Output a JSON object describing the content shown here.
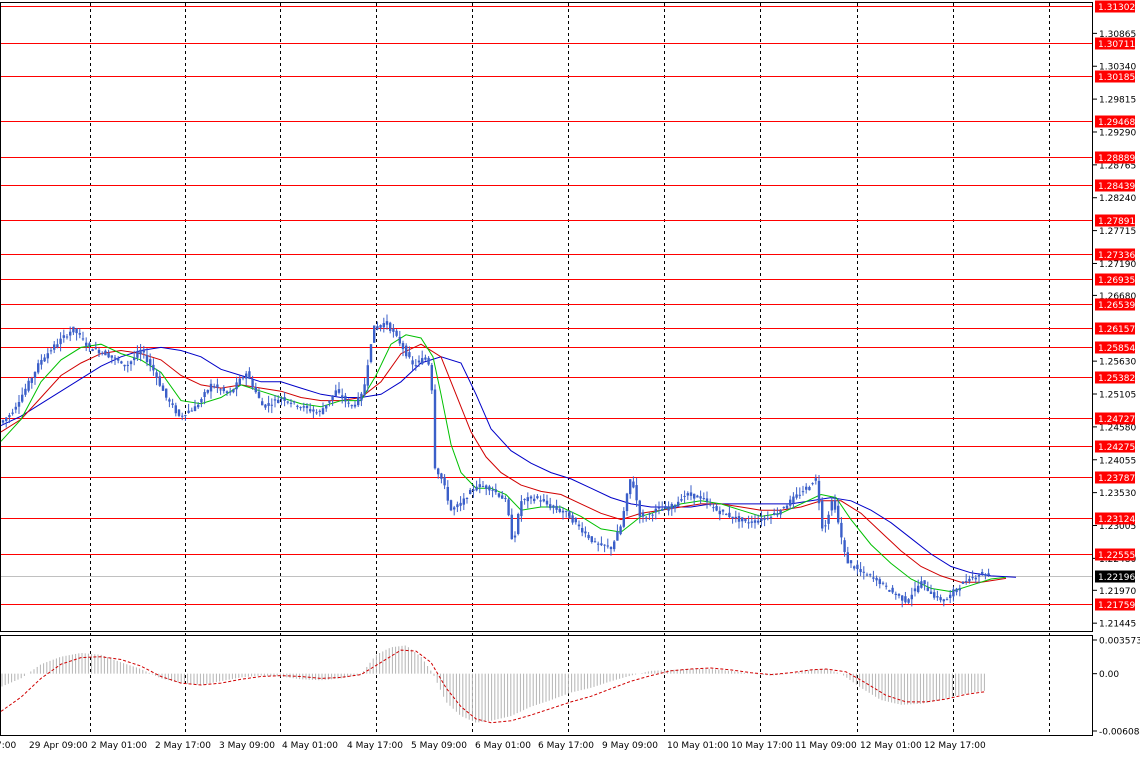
{
  "chart_data": [
    {
      "type": "candlestick",
      "symbol_title": "",
      "price_range": [
        1.2132,
        1.3135
      ],
      "price_ticks": [
        "1.30865",
        "1.30340",
        "1.29815",
        "1.29290",
        "1.28765",
        "1.28240",
        "1.27715",
        "1.27190",
        "1.26680",
        "1.25630",
        "1.25105",
        "1.24580",
        "1.24055",
        "1.23530",
        "1.23005",
        "1.22480",
        "1.21970",
        "1.21445"
      ],
      "levels": [
        "1.31302",
        "1.30711",
        "1.30185",
        "1.29468",
        "1.28889",
        "1.28439",
        "1.27891",
        "1.27336",
        "1.26935",
        "1.26539",
        "1.26157",
        "1.25854",
        "1.25382",
        "1.24727",
        "1.24275",
        "1.23787",
        "1.23124",
        "1.22555",
        "1.21759"
      ],
      "current_price": "1.22196",
      "time_labels": [
        "7:00",
        "29 Apr 09:00",
        "2 May 01:00",
        "2 May 17:00",
        "3 May 09:00",
        "4 May 01:00",
        "4 May 17:00",
        "5 May 09:00",
        "6 May 01:00",
        "6 May 17:00",
        "9 May 09:00",
        "10 May 01:00",
        "10 May 17:00",
        "11 May 09:00",
        "12 May 01:00",
        "12 May 17:00"
      ],
      "price_path": [
        [
          0,
          1.2465
        ],
        [
          10,
          1.248
        ],
        [
          25,
          1.252
        ],
        [
          40,
          1.2565
        ],
        [
          55,
          1.259
        ],
        [
          72,
          1.2615
        ],
        [
          88,
          1.2585
        ],
        [
          105,
          1.2575
        ],
        [
          125,
          1.2555
        ],
        [
          140,
          1.258
        ],
        [
          152,
          1.255
        ],
        [
          165,
          1.2505
        ],
        [
          178,
          1.2475
        ],
        [
          195,
          1.249
        ],
        [
          210,
          1.2525
        ],
        [
          228,
          1.251
        ],
        [
          245,
          1.2545
        ],
        [
          262,
          1.249
        ],
        [
          280,
          1.2505
        ],
        [
          300,
          1.249
        ],
        [
          318,
          1.248
        ],
        [
          335,
          1.2515
        ],
        [
          350,
          1.249
        ],
        [
          362,
          1.251
        ],
        [
          372,
          1.2615
        ],
        [
          385,
          1.2625
        ],
        [
          400,
          1.259
        ],
        [
          412,
          1.2555
        ],
        [
          425,
          1.257
        ],
        [
          430,
          1.255
        ],
        [
          434,
          1.2395
        ],
        [
          442,
          1.237
        ],
        [
          450,
          1.2325
        ],
        [
          460,
          1.2335
        ],
        [
          475,
          1.2365
        ],
        [
          490,
          1.236
        ],
        [
          505,
          1.234
        ],
        [
          512,
          1.227
        ],
        [
          520,
          1.234
        ],
        [
          535,
          1.2345
        ],
        [
          550,
          1.233
        ],
        [
          565,
          1.232
        ],
        [
          580,
          1.2295
        ],
        [
          595,
          1.227
        ],
        [
          610,
          1.2265
        ],
        [
          620,
          1.23
        ],
        [
          630,
          1.238
        ],
        [
          640,
          1.231
        ],
        [
          655,
          1.2325
        ],
        [
          670,
          1.233
        ],
        [
          685,
          1.235
        ],
        [
          700,
          1.2345
        ],
        [
          715,
          1.2325
        ],
        [
          730,
          1.2315
        ],
        [
          745,
          1.2305
        ],
        [
          760,
          1.231
        ],
        [
          775,
          1.232
        ],
        [
          790,
          1.234
        ],
        [
          805,
          1.236
        ],
        [
          815,
          1.2375
        ],
        [
          822,
          1.229
        ],
        [
          832,
          1.2345
        ],
        [
          845,
          1.2245
        ],
        [
          860,
          1.2225
        ],
        [
          875,
          1.2215
        ],
        [
          890,
          1.2195
        ],
        [
          905,
          1.218
        ],
        [
          920,
          1.221
        ],
        [
          935,
          1.2185
        ],
        [
          945,
          1.218
        ],
        [
          955,
          1.22
        ],
        [
          968,
          1.2215
        ],
        [
          980,
          1.2225
        ],
        [
          990,
          1.222
        ]
      ],
      "ma_fast": [
        [
          0,
          1.2435
        ],
        [
          20,
          1.247
        ],
        [
          40,
          1.253
        ],
        [
          60,
          1.2565
        ],
        [
          80,
          1.2585
        ],
        [
          100,
          1.259
        ],
        [
          120,
          1.2575
        ],
        [
          140,
          1.2565
        ],
        [
          160,
          1.2545
        ],
        [
          180,
          1.25
        ],
        [
          200,
          1.2495
        ],
        [
          220,
          1.2505
        ],
        [
          240,
          1.2525
        ],
        [
          260,
          1.2515
        ],
        [
          280,
          1.2505
        ],
        [
          300,
          1.2495
        ],
        [
          320,
          1.249
        ],
        [
          340,
          1.25
        ],
        [
          360,
          1.25
        ],
        [
          375,
          1.254
        ],
        [
          390,
          1.259
        ],
        [
          405,
          1.2605
        ],
        [
          420,
          1.26
        ],
        [
          432,
          1.257
        ],
        [
          440,
          1.251
        ],
        [
          450,
          1.243
        ],
        [
          460,
          1.2385
        ],
        [
          475,
          1.236
        ],
        [
          490,
          1.236
        ],
        [
          505,
          1.235
        ],
        [
          520,
          1.2325
        ],
        [
          540,
          1.233
        ],
        [
          560,
          1.233
        ],
        [
          580,
          1.2315
        ],
        [
          600,
          1.2295
        ],
        [
          620,
          1.229
        ],
        [
          640,
          1.2315
        ],
        [
          660,
          1.2325
        ],
        [
          680,
          1.2335
        ],
        [
          700,
          1.234
        ],
        [
          720,
          1.2335
        ],
        [
          740,
          1.2325
        ],
        [
          760,
          1.2315
        ],
        [
          780,
          1.232
        ],
        [
          800,
          1.2335
        ],
        [
          820,
          1.235
        ],
        [
          835,
          1.2345
        ],
        [
          850,
          1.231
        ],
        [
          870,
          1.227
        ],
        [
          890,
          1.224
        ],
        [
          910,
          1.2215
        ],
        [
          930,
          1.22
        ],
        [
          950,
          1.2195
        ],
        [
          970,
          1.2205
        ],
        [
          990,
          1.2215
        ],
        [
          1005,
          1.2218
        ]
      ],
      "ma_mid": [
        [
          0,
          1.245
        ],
        [
          20,
          1.247
        ],
        [
          40,
          1.2505
        ],
        [
          60,
          1.254
        ],
        [
          80,
          1.256
        ],
        [
          100,
          1.2575
        ],
        [
          120,
          1.258
        ],
        [
          140,
          1.2575
        ],
        [
          160,
          1.2565
        ],
        [
          180,
          1.254
        ],
        [
          200,
          1.2525
        ],
        [
          220,
          1.252
        ],
        [
          240,
          1.2525
        ],
        [
          260,
          1.252
        ],
        [
          280,
          1.2515
        ],
        [
          300,
          1.2505
        ],
        [
          320,
          1.25
        ],
        [
          340,
          1.25
        ],
        [
          360,
          1.2505
        ],
        [
          380,
          1.253
        ],
        [
          400,
          1.2575
        ],
        [
          420,
          1.259
        ],
        [
          440,
          1.257
        ],
        [
          455,
          1.251
        ],
        [
          470,
          1.245
        ],
        [
          485,
          1.241
        ],
        [
          500,
          1.2385
        ],
        [
          520,
          1.2365
        ],
        [
          540,
          1.2355
        ],
        [
          560,
          1.235
        ],
        [
          580,
          1.2335
        ],
        [
          600,
          1.232
        ],
        [
          620,
          1.231
        ],
        [
          640,
          1.232
        ],
        [
          660,
          1.2325
        ],
        [
          680,
          1.233
        ],
        [
          700,
          1.2335
        ],
        [
          720,
          1.2335
        ],
        [
          740,
          1.233
        ],
        [
          760,
          1.2325
        ],
        [
          780,
          1.2325
        ],
        [
          800,
          1.233
        ],
        [
          820,
          1.234
        ],
        [
          840,
          1.234
        ],
        [
          860,
          1.232
        ],
        [
          880,
          1.229
        ],
        [
          900,
          1.226
        ],
        [
          920,
          1.2235
        ],
        [
          940,
          1.222
        ],
        [
          960,
          1.221
        ],
        [
          980,
          1.221
        ],
        [
          1005,
          1.2216
        ]
      ],
      "ma_slow": [
        [
          0,
          1.246
        ],
        [
          20,
          1.2475
        ],
        [
          40,
          1.2495
        ],
        [
          60,
          1.2515
        ],
        [
          80,
          1.2535
        ],
        [
          100,
          1.2555
        ],
        [
          120,
          1.257
        ],
        [
          140,
          1.258
        ],
        [
          160,
          1.2585
        ],
        [
          180,
          1.258
        ],
        [
          200,
          1.257
        ],
        [
          220,
          1.255
        ],
        [
          240,
          1.254
        ],
        [
          260,
          1.253
        ],
        [
          280,
          1.253
        ],
        [
          300,
          1.252
        ],
        [
          320,
          1.251
        ],
        [
          340,
          1.2505
        ],
        [
          360,
          1.2505
        ],
        [
          380,
          1.251
        ],
        [
          400,
          1.253
        ],
        [
          420,
          1.256
        ],
        [
          440,
          1.257
        ],
        [
          460,
          1.256
        ],
        [
          475,
          1.251
        ],
        [
          490,
          1.2455
        ],
        [
          510,
          1.242
        ],
        [
          530,
          1.24
        ],
        [
          550,
          1.2385
        ],
        [
          570,
          1.2375
        ],
        [
          590,
          1.236
        ],
        [
          610,
          1.2345
        ],
        [
          630,
          1.2335
        ],
        [
          650,
          1.233
        ],
        [
          670,
          1.233
        ],
        [
          690,
          1.233
        ],
        [
          710,
          1.2335
        ],
        [
          730,
          1.2335
        ],
        [
          750,
          1.2335
        ],
        [
          770,
          1.2335
        ],
        [
          790,
          1.2335
        ],
        [
          810,
          1.234
        ],
        [
          830,
          1.2345
        ],
        [
          850,
          1.234
        ],
        [
          870,
          1.2325
        ],
        [
          890,
          1.2305
        ],
        [
          910,
          1.228
        ],
        [
          930,
          1.2255
        ],
        [
          950,
          1.2235
        ],
        [
          970,
          1.2225
        ],
        [
          990,
          1.222
        ],
        [
          1015,
          1.2218
        ]
      ]
    },
    {
      "type": "histogram",
      "indicator_title": "",
      "range": [
        -0.006084,
        0.003573
      ],
      "ticks": [
        "0.003573",
        "0.00",
        "-0.006084"
      ],
      "histogram": [
        [
          0,
          -0.0014
        ],
        [
          20,
          -0.0005
        ],
        [
          40,
          0.001
        ],
        [
          60,
          0.0018
        ],
        [
          80,
          0.0022
        ],
        [
          100,
          0.002
        ],
        [
          120,
          0.0012
        ],
        [
          140,
          0.0005
        ],
        [
          160,
          -0.0005
        ],
        [
          180,
          -0.001
        ],
        [
          200,
          -0.0012
        ],
        [
          220,
          -0.0008
        ],
        [
          240,
          -0.0004
        ],
        [
          260,
          -0.0002
        ],
        [
          280,
          -0.0003
        ],
        [
          300,
          -0.0006
        ],
        [
          320,
          -0.0007
        ],
        [
          340,
          -0.0005
        ],
        [
          360,
          -0.0001
        ],
        [
          375,
          0.002
        ],
        [
          390,
          0.0028
        ],
        [
          405,
          0.003
        ],
        [
          420,
          0.0018
        ],
        [
          432,
          0.0
        ],
        [
          445,
          -0.003
        ],
        [
          460,
          -0.0045
        ],
        [
          475,
          -0.0052
        ],
        [
          490,
          -0.005
        ],
        [
          510,
          -0.0045
        ],
        [
          530,
          -0.0035
        ],
        [
          550,
          -0.0028
        ],
        [
          570,
          -0.002
        ],
        [
          590,
          -0.0015
        ],
        [
          610,
          -0.0008
        ],
        [
          630,
          -0.0002
        ],
        [
          650,
          0.0003
        ],
        [
          670,
          0.0004
        ],
        [
          690,
          0.0005
        ],
        [
          710,
          0.0005
        ],
        [
          730,
          0.0003
        ],
        [
          750,
          0.0
        ],
        [
          770,
          -0.0002
        ],
        [
          790,
          0.0
        ],
        [
          810,
          0.0004
        ],
        [
          825,
          0.0005
        ],
        [
          840,
          0.0
        ],
        [
          860,
          -0.0015
        ],
        [
          880,
          -0.0028
        ],
        [
          900,
          -0.0033
        ],
        [
          920,
          -0.0032
        ],
        [
          940,
          -0.0028
        ],
        [
          960,
          -0.0022
        ],
        [
          985,
          -0.0018
        ]
      ],
      "signal": [
        [
          0,
          -0.004
        ],
        [
          20,
          -0.0025
        ],
        [
          40,
          -0.0005
        ],
        [
          60,
          0.001
        ],
        [
          80,
          0.0017
        ],
        [
          100,
          0.0018
        ],
        [
          120,
          0.0015
        ],
        [
          140,
          0.0008
        ],
        [
          160,
          -0.0003
        ],
        [
          180,
          -0.001
        ],
        [
          200,
          -0.0012
        ],
        [
          220,
          -0.001
        ],
        [
          240,
          -0.0006
        ],
        [
          260,
          -0.0003
        ],
        [
          280,
          -0.0002
        ],
        [
          300,
          -0.0003
        ],
        [
          320,
          -0.0005
        ],
        [
          340,
          -0.0004
        ],
        [
          360,
          -0.0001
        ],
        [
          380,
          0.0012
        ],
        [
          400,
          0.0025
        ],
        [
          415,
          0.0024
        ],
        [
          430,
          0.0012
        ],
        [
          445,
          -0.0015
        ],
        [
          460,
          -0.0035
        ],
        [
          475,
          -0.0048
        ],
        [
          490,
          -0.0052
        ],
        [
          510,
          -0.005
        ],
        [
          530,
          -0.0044
        ],
        [
          550,
          -0.0037
        ],
        [
          570,
          -0.003
        ],
        [
          590,
          -0.0024
        ],
        [
          610,
          -0.0016
        ],
        [
          630,
          -0.0008
        ],
        [
          650,
          -0.0002
        ],
        [
          670,
          0.0003
        ],
        [
          690,
          0.0005
        ],
        [
          710,
          0.0006
        ],
        [
          730,
          0.0004
        ],
        [
          750,
          0.0001
        ],
        [
          770,
          -0.0001
        ],
        [
          790,
          0.0001
        ],
        [
          810,
          0.0004
        ],
        [
          825,
          0.0005
        ],
        [
          845,
          0.0002
        ],
        [
          865,
          -0.001
        ],
        [
          885,
          -0.0023
        ],
        [
          905,
          -0.003
        ],
        [
          925,
          -0.003
        ],
        [
          945,
          -0.0027
        ],
        [
          965,
          -0.0022
        ],
        [
          985,
          -0.0019
        ]
      ]
    }
  ],
  "colors": {
    "level_line": "#ff0000",
    "candle": "#3b5fc9",
    "ma_fast": "#00c000",
    "ma_mid": "#d00000",
    "ma_slow": "#0000c8",
    "histogram": "#b4b4b4",
    "signal": "#d00000",
    "current_price_bg": "#000000",
    "grid": "#000000",
    "background": "#ffffff"
  }
}
